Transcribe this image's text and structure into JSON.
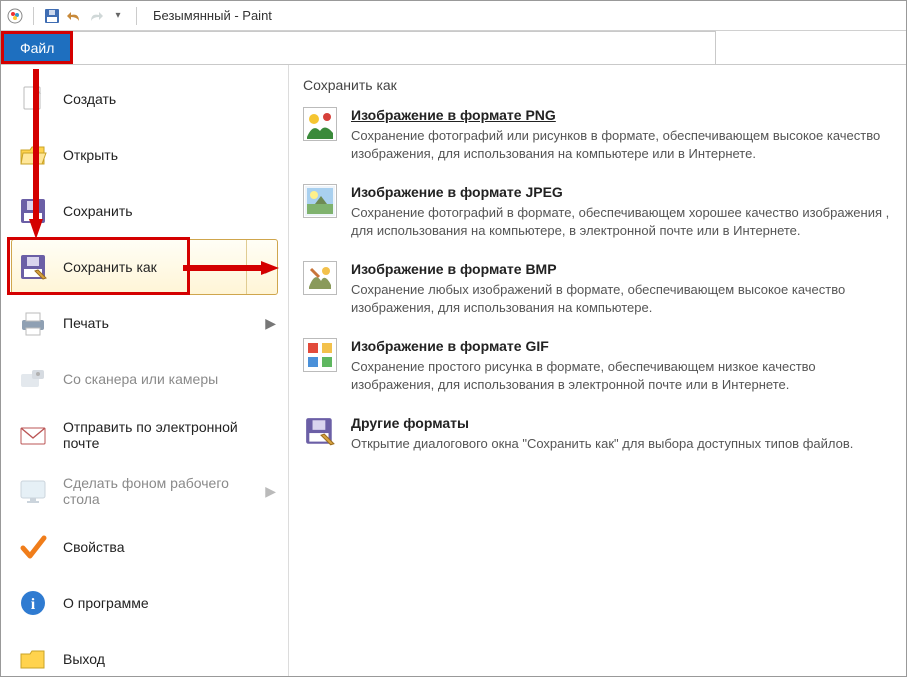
{
  "title": "Безымянный - Paint",
  "tabs": {
    "file": "Файл"
  },
  "menu": {
    "new": "Создать",
    "open": "Открыть",
    "save": "Сохранить",
    "saveas": "Сохранить как",
    "print": "Печать",
    "scanner": "Со сканера или камеры",
    "email": "Отправить по электронной почте",
    "wallpaper": "Сделать фоном рабочего стола",
    "properties": "Свойства",
    "about": "О программе",
    "exit": "Выход"
  },
  "right": {
    "heading": "Сохранить как",
    "items": [
      {
        "key": "png",
        "title": "Изображение в формате PNG",
        "desc": "Сохранение фотографий или рисунков в формате, обеспечивающем высокое качество изображения, для использования на компьютере или в Интернете."
      },
      {
        "key": "jpeg",
        "title": "Изображение в формате JPEG",
        "desc": "Сохранение фотографий в формате, обеспечивающем хорошее качество изображения , для использования на компьютере, в электронной почте или в Интернете."
      },
      {
        "key": "bmp",
        "title": "Изображение в формате BMP",
        "desc": "Сохранение любых изображений в формате, обеспечивающем высокое качество изображения, для использования на компьютере."
      },
      {
        "key": "gif",
        "title": "Изображение в формате GIF",
        "desc": "Сохранение простого рисунка в формате, обеспечивающем низкое качество изображения, для использования в электронной почте или в Интернете."
      },
      {
        "key": "other",
        "title": "Другие форматы",
        "desc": "Открытие диалогового окна \"Сохранить как\" для выбора доступных типов файлов."
      }
    ]
  },
  "annotations": {
    "highlight_file_tab": true,
    "highlight_saveas": true
  }
}
